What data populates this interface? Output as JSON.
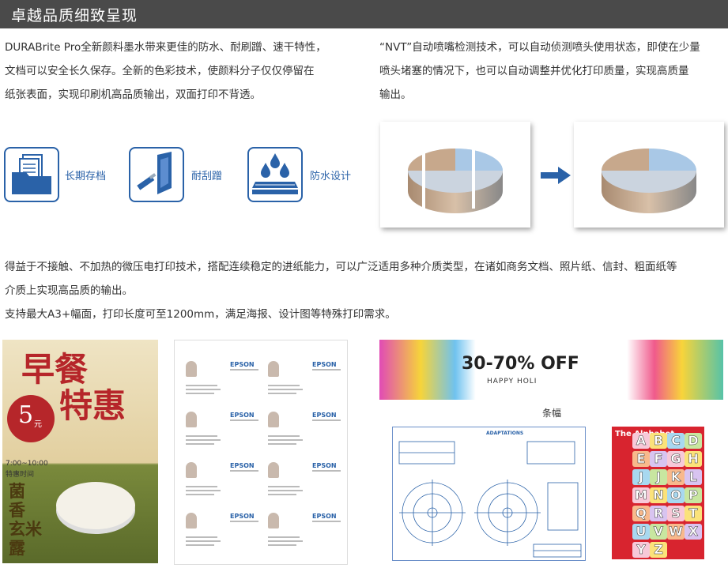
{
  "header": {
    "title": "卓越品质细致呈现"
  },
  "section1": {
    "left_lines": [
      "DURABrite Pro全新颜料墨水带来更佳的防水、耐刷蹭、速干特性，",
      "文档可以安全长久保存。全新的色彩技术，使颜料分子仅仅停留在",
      "纸张表面，实现印刷机高品质输出，双面打印不背透。"
    ],
    "right_lines": [
      "“NVT”自动喷嘴检测技术，可以自动侦测喷头使用状态，即使在少量",
      "喷头堵塞的情况下，也可以自动调整并优化打印质量，实现高质量",
      "输出。"
    ]
  },
  "features": [
    {
      "label": "长期存档",
      "icon": "folder-documents-icon"
    },
    {
      "label": "耐刮蹭",
      "icon": "scratch-resistant-icon"
    },
    {
      "label": "防水设计",
      "icon": "waterproof-icon"
    }
  ],
  "section2": {
    "lines": [
      "得益于不接触、不加热的微压电打印技术，搭配连续稳定的进纸能力，可以广泛适用多种介质类型，在诸如商务文档、照片纸、信封、粗面纸等",
      "介质上实现高品质的输出。",
      "支持最大A3+幅面，打印长度可至1200mm，满足海报、设计图等特殊打印需求。"
    ]
  },
  "poster": {
    "title1": "早餐",
    "title2": "特惠",
    "price": "5",
    "price_unit": "元",
    "time": "7:00~10:00",
    "time_label": "特惠时间",
    "dish": [
      "菌",
      "香",
      "玄",
      "米",
      "露"
    ]
  },
  "business_cards": {
    "brand": "EPSON"
  },
  "banner": {
    "headline": "30-70% OFF",
    "subline": "HAPPY HOLI",
    "caption": "条幅"
  },
  "drawing": {
    "title": "ADAPTATIONS"
  },
  "alphabet": {
    "title": "The Alphabet",
    "letters": [
      "A",
      "B",
      "C",
      "D",
      "E",
      "F",
      "G",
      "H",
      "J",
      "J",
      "K",
      "L",
      "M",
      "N",
      "O",
      "P",
      "Q",
      "R",
      "S",
      "T",
      "U",
      "V",
      "W",
      "X",
      "Y",
      "Z"
    ]
  },
  "colors": {
    "header_bg": "#4a4a4a",
    "accent_blue": "#2a62a8",
    "alphabet_bg": "#d8242f"
  }
}
